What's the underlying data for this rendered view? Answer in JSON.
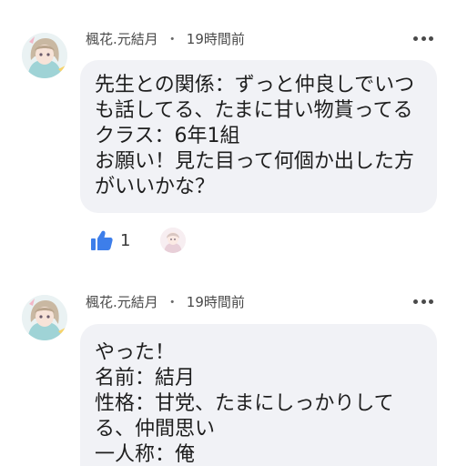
{
  "comments": [
    {
      "author": "楓花.元結月",
      "separator": "・",
      "time": "19時間前",
      "lines": [
        "先生との関係：ずっと仲良しでいつ",
        "も話してる、たまに甘い物貰ってる",
        "クラス：6年1組",
        "お願い！見た目って何個か出した方",
        "がいいかな？"
      ],
      "like_count": "1"
    },
    {
      "author": "楓花.元結月",
      "separator": "・",
      "time": "19時間前",
      "lines": [
        "やった！",
        "名前：結月",
        "性格：甘党、たまにしっかりして",
        "る、仲間思い",
        "一人称：俺"
      ]
    }
  ],
  "icons": {
    "more": "more-horizontal-icon",
    "like": "thumbs-up-icon"
  },
  "colors": {
    "bubble": "#f1f2f6",
    "like": "#3d7eea",
    "meta_text": "#4a4a4a"
  }
}
